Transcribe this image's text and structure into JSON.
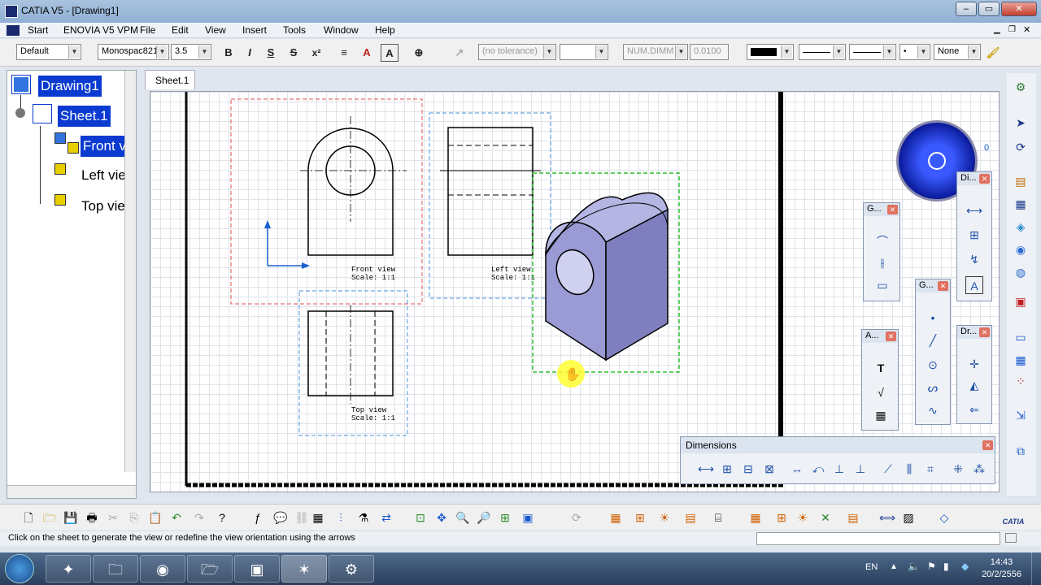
{
  "window": {
    "title": "CATIA V5 - [Drawing1]",
    "min": "‒",
    "max": "▭",
    "close": "✕"
  },
  "menu": [
    "Start",
    "ENOVIA V5 VPM",
    "File",
    "Edit",
    "View",
    "Insert",
    "Tools",
    "Window",
    "Help"
  ],
  "format": {
    "style": "Default",
    "font": "Monospac821",
    "size": "3.5",
    "bold": "B",
    "italic": "I",
    "underline": "S",
    "strike": "S",
    "superscript": "x²",
    "tolerance": "(no tolerance)",
    "numdim": "NUM.DIMM",
    "precision": "0.0100",
    "none": "None"
  },
  "tree": {
    "root": "Drawing1",
    "sheet": "Sheet.1",
    "views": [
      "Front v",
      "Left vie",
      "Top vie"
    ]
  },
  "sheet_tab": "Sheet.1",
  "views": {
    "front": {
      "label": "Front view",
      "scale": "Scale:  1:1"
    },
    "left": {
      "label": "Left view",
      "scale": "Scale:  1:1"
    },
    "top": {
      "label": "Top view",
      "scale": "Scale:  1:1"
    }
  },
  "compass_value": "0",
  "palettes": {
    "g1": "G...",
    "g2": "G...",
    "di": "Di...",
    "a": "A...",
    "dr": "Dr...",
    "dimensions": "Dimensions"
  },
  "status": "Click on the sheet to generate the view or redefine the view orientation using the arrows",
  "taskbar": {
    "lang": "EN",
    "time": "14:43",
    "date": "20/2/2556"
  },
  "colors": {
    "select": "#0a3ad0",
    "front_frame": "#e05050",
    "left_frame": "#4a90d9",
    "iso_frame": "#2ec02e",
    "solid": "#8888c8"
  }
}
